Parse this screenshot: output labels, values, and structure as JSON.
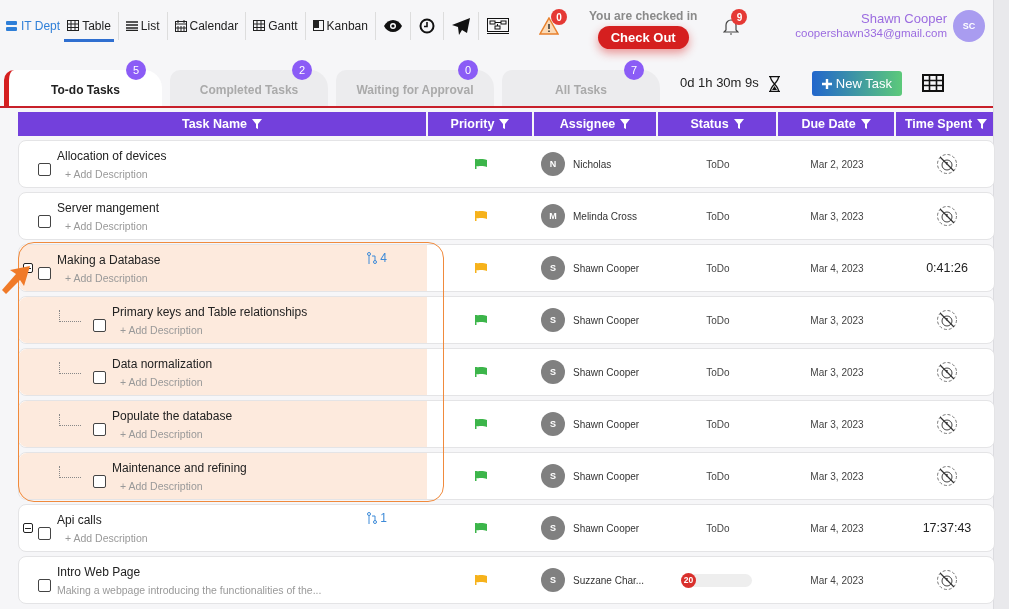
{
  "workspace": {
    "label": "IT Dept"
  },
  "views": [
    {
      "label": "Table",
      "selected": true
    },
    {
      "label": "List",
      "selected": false
    },
    {
      "label": "Calendar",
      "selected": false
    },
    {
      "label": "Gantt",
      "selected": false
    },
    {
      "label": "Kanban",
      "selected": false
    }
  ],
  "alerts": {
    "count": "0"
  },
  "checkin": {
    "status": "You are checked in",
    "button": "Check Out"
  },
  "notifications": {
    "count": "9"
  },
  "user": {
    "name": "Shawn Cooper",
    "email": "coopershawn334@gmail.com",
    "initials": "SC"
  },
  "task_tabs": [
    {
      "label": "To-do Tasks",
      "count": "5",
      "selected": true
    },
    {
      "label": "Completed Tasks",
      "count": "2",
      "selected": false
    },
    {
      "label": "Waiting for Approval",
      "count": "0",
      "selected": false
    },
    {
      "label": "All Tasks",
      "count": "7",
      "selected": false
    }
  ],
  "timer": "0d 1h 30m 9s",
  "new_task_button": "New Task",
  "table": {
    "columns": [
      "Task Name",
      "Priority",
      "Assignee",
      "Status",
      "Due Date",
      "Time Spent"
    ],
    "rows": [
      {
        "name": "Allocation of devices",
        "checked": false,
        "description": "+ Add Description",
        "placeholder_description": true,
        "color": "#3cb54a",
        "assignee": "Nicholas",
        "initial": "N",
        "status": {
          "kind": "text",
          "label": "ToDo"
        },
        "due": "Mar 2, 2023",
        "highlighted": false
      },
      {
        "name": "Server mangement",
        "checked": false,
        "description": "+ Add Description",
        "placeholder_description": true,
        "color": "#f6b21b",
        "assignee": "Melinda Cross",
        "initial": "M",
        "status": {
          "kind": "text",
          "label": "ToDo"
        },
        "due": "Mar 3, 2023",
        "highlighted": false
      },
      {
        "name": "Making a Database",
        "checked": false,
        "description": "+ Add Description",
        "placeholder_description": true,
        "expanded": true,
        "subtasks": "4",
        "color": "#f6b21b",
        "assignee": "Shawn Cooper",
        "initial": "S",
        "status": {
          "kind": "text",
          "label": "ToDo"
        },
        "due": "Mar 4, 2023",
        "time_spent": "0:41:26",
        "highlighted": true,
        "children": [
          {
            "name": "Primary keys and Table relationships",
            "checked": false,
            "description": "+ Add Description",
            "placeholder_description": true,
            "color": "#3cb54a",
            "assignee": "Shawn Cooper",
            "initial": "S",
            "status": {
              "kind": "text",
              "label": "ToDo"
            },
            "due": "Mar 3, 2023"
          },
          {
            "name": "Data normalization",
            "checked": false,
            "description": "+ Add Description",
            "placeholder_description": true,
            "color": "#3cb54a",
            "assignee": "Shawn Cooper",
            "initial": "S",
            "status": {
              "kind": "text",
              "label": "ToDo"
            },
            "due": "Mar 3, 2023"
          },
          {
            "name": "Populate the database",
            "checked": false,
            "description": "+ Add Description",
            "placeholder_description": true,
            "color": "#3cb54a",
            "assignee": "Shawn Cooper",
            "initial": "S",
            "status": {
              "kind": "text",
              "label": "ToDo"
            },
            "due": "Mar 3, 2023"
          },
          {
            "name": "Maintenance and refining",
            "checked": false,
            "description": "+ Add Description",
            "placeholder_description": true,
            "color": "#3cb54a",
            "assignee": "Shawn Cooper",
            "initial": "S",
            "status": {
              "kind": "text",
              "label": "ToDo"
            },
            "due": "Mar 3, 2023"
          }
        ]
      },
      {
        "name": "Api calls",
        "checked": false,
        "description": "+ Add Description",
        "placeholder_description": true,
        "expanded": true,
        "subtasks": "1",
        "color": "#3cb54a",
        "assignee": "Shawn Cooper",
        "initial": "S",
        "status": {
          "kind": "text",
          "label": "ToDo"
        },
        "due": "Mar 4, 2023",
        "time_spent": "17:37:43",
        "highlighted": false
      },
      {
        "name": "Intro Web Page",
        "checked": false,
        "description": "Making a webpage introducing the functionalities of the...",
        "placeholder_description": false,
        "color": "#f6b21b",
        "assignee": "Suzzane Char...",
        "initial": "S",
        "status": {
          "kind": "progress",
          "label": "20",
          "level": 0.2
        },
        "due": "Mar 4, 2023",
        "highlighted": false
      }
    ]
  }
}
